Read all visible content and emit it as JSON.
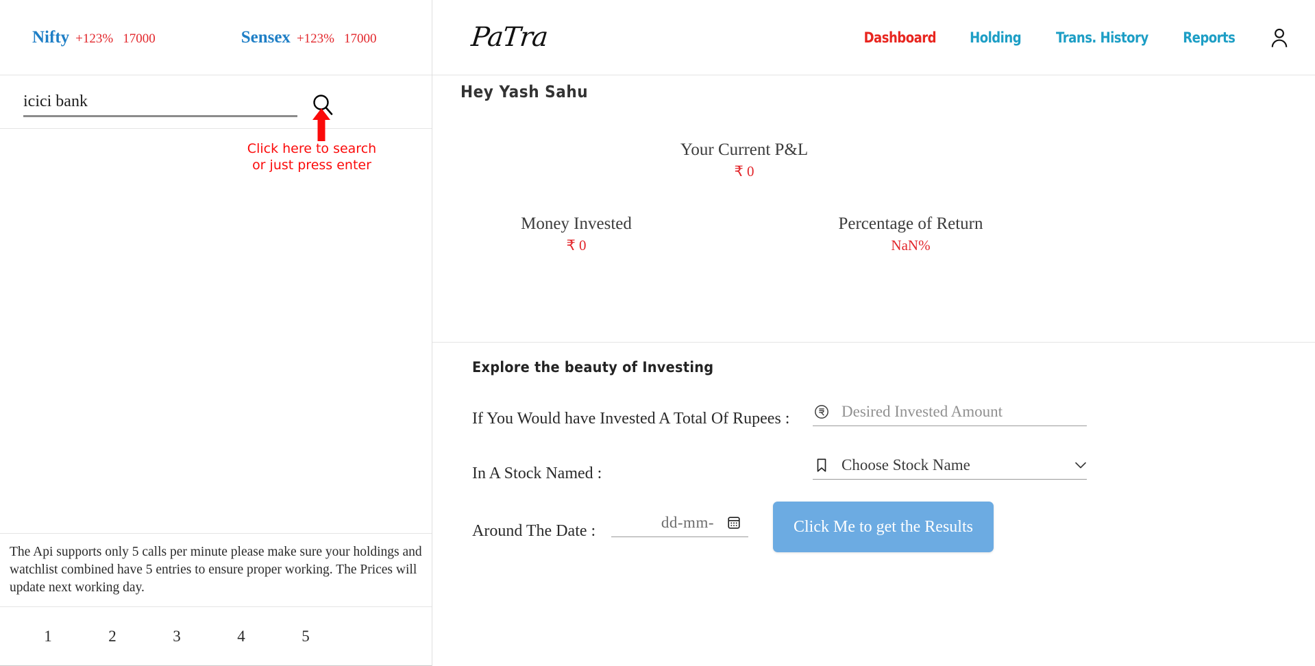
{
  "indices": [
    {
      "name": "Nifty",
      "change": "+123%",
      "value": "17000"
    },
    {
      "name": "Sensex",
      "change": "+123%",
      "value": "17000"
    }
  ],
  "search": {
    "value": "icici bank",
    "placeholder": "",
    "icon": "search-icon"
  },
  "annotation": {
    "line1": "Click here to search",
    "line2": "or just press enter",
    "color": "#fb0a0a",
    "arrow": "arrow-up-icon"
  },
  "api_note": "The Api supports only 5 calls per minute please make sure your holdings and watchlist combined have 5 entries to ensure proper working. The Prices will update next working day.",
  "pagination": [
    "1",
    "2",
    "3",
    "4",
    "5"
  ],
  "brand": {
    "name": "PaTra"
  },
  "nav": {
    "links": [
      {
        "label": "Dashboard",
        "active": true,
        "color": "#e8251f"
      },
      {
        "label": "Holding",
        "active": false,
        "color": "#1d9ec5"
      },
      {
        "label": "Trans. History",
        "active": false,
        "color": "#1d9ec5"
      },
      {
        "label": "Reports",
        "active": false,
        "color": "#1d9ec5"
      }
    ],
    "avatar_icon": "user-icon"
  },
  "summary": {
    "greeting": "Hey Yash Sahu",
    "pnl": {
      "label": "Your Current P&L",
      "value": "₹  0"
    },
    "money": {
      "label": "Money Invested",
      "value": "₹  0"
    },
    "pct": {
      "label": "Percentage of Return",
      "value": "NaN%"
    },
    "value_color": "#e2252a"
  },
  "explore": {
    "title": "Explore the beauty of Investing",
    "amount": {
      "label": "If You Would have Invested A Total Of Rupees :",
      "placeholder": "Desired Invested Amount",
      "value": "",
      "icon": "rupee-circle-icon"
    },
    "stock": {
      "label": "In A Stock Named :",
      "selected": "Choose Stock Name",
      "icon": "bookmark-icon",
      "chevron": "chevron-down-icon"
    },
    "date": {
      "label": "Around The Date :",
      "placeholder": "dd-mm-",
      "icon": "calendar-icon"
    },
    "cta_label": "Click Me to get the Results",
    "cta_color": "#6cabe2"
  }
}
